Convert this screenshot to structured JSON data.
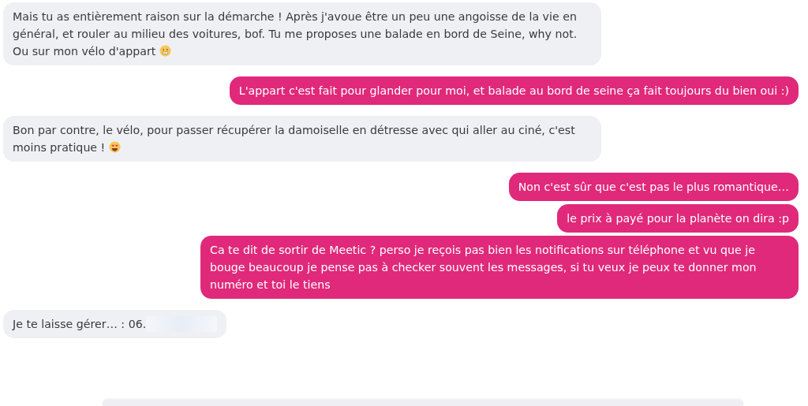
{
  "messages": [
    {
      "kind": "received",
      "text": "Mais tu as entièrement raison sur la démarche ! Après j'avoue être un peu une angoisse de la vie en général, et rouler au milieu des voitures, bof. Tu me proposes une balade en bord de Seine, why not. Ou sur mon vélo d'appart",
      "emoji": {
        "kind": "grimace"
      }
    },
    {
      "kind": "sent",
      "text": "L'appart c'est fait pour glander pour moi, et balade au bord de seine ça fait toujours du bien oui :)"
    },
    {
      "kind": "received",
      "text": "Bon par contre, le vélo, pour passer récupérer la damoiselle en détresse avec qui aller au ciné, c'est moins pratique !",
      "emoji": {
        "kind": "heart-eyes"
      }
    },
    {
      "kind": "sent",
      "text": "Non c'est sûr que c'est pas le plus romantique…"
    },
    {
      "kind": "sent",
      "text": "le prix à payé pour la planète on dira :p"
    },
    {
      "kind": "sent",
      "text": "Ca te dit de sortir de Meetic ? perso je reçois pas bien les notifications sur téléphone et vu que je bouge beaucoup je pense pas à checker souvent les messages, si tu veux je peux te donner mon numéro et toi le tiens"
    },
    {
      "kind": "received",
      "text": "Je te laisse gérer… : 06.",
      "redacted": true
    }
  ]
}
